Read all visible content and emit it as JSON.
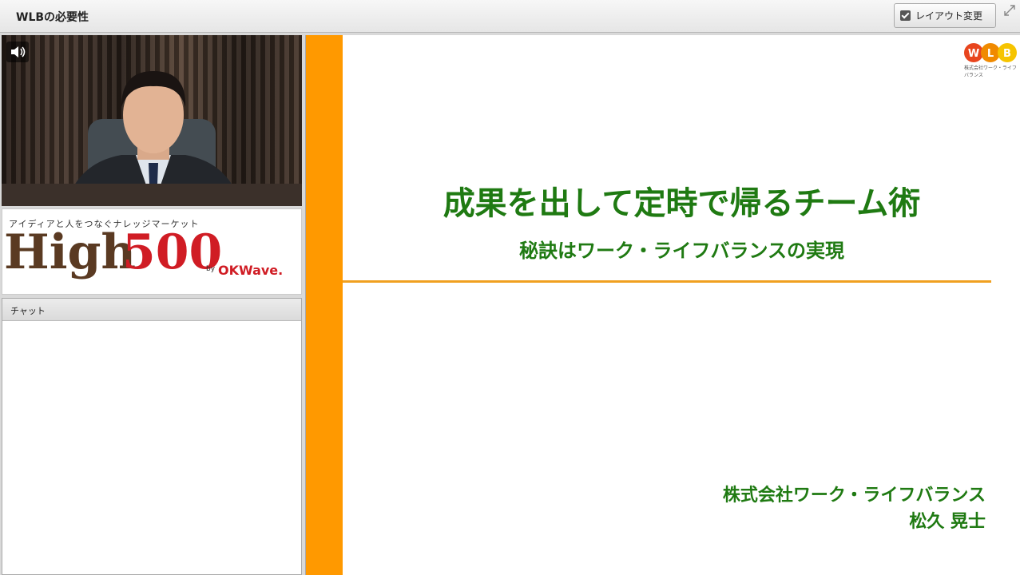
{
  "window": {
    "title": "WLBの必要性"
  },
  "toolbar": {
    "layout_button_label": "レイアウト変更"
  },
  "banner": {
    "tagline": "アイディアと人をつなぐナレッジマーケット",
    "brand_text": "High",
    "brand_number": "500",
    "by_text": "by",
    "partner": "OKWave."
  },
  "chat": {
    "header": "チャット"
  },
  "slide": {
    "title": "成果を出して定時で帰るチーム術",
    "subtitle": "秘訣はワーク・ライフバランスの実現",
    "company": "株式会社ワーク・ライフバランス",
    "presenter": "松久 晃士",
    "logo_letters": [
      "W",
      "L",
      "B"
    ],
    "logo_caption": "株式会社ワーク・ライフバランス"
  },
  "colors": {
    "accent_orange": "#ff9900",
    "title_green": "#1f7a12",
    "logo_red": "#d01c24"
  }
}
